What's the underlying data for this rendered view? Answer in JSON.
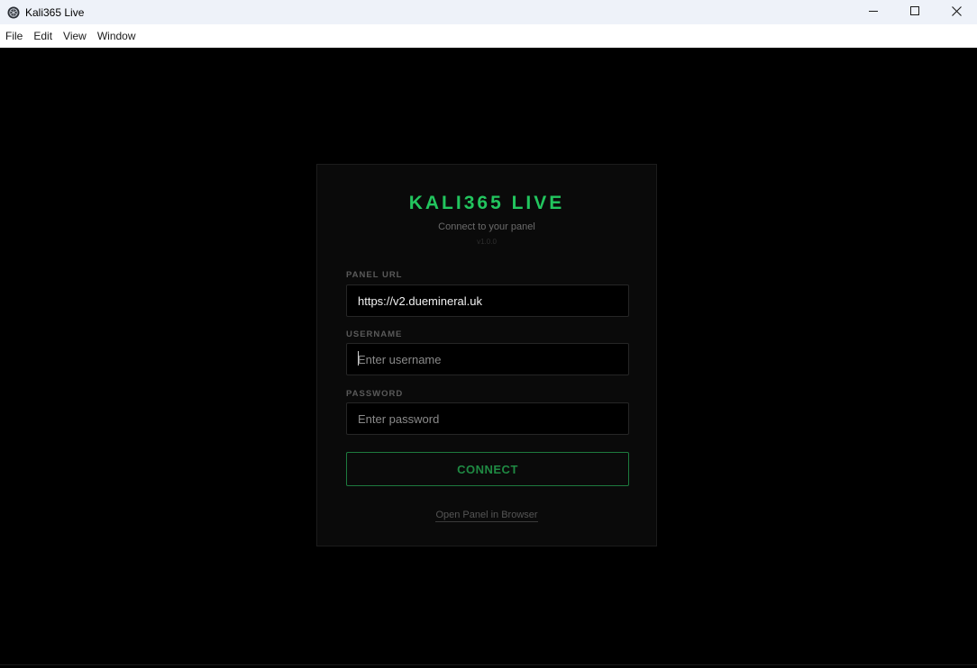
{
  "window": {
    "title": "Kali365 Live",
    "icon": "app-logo-icon",
    "controls": [
      "minimize-icon",
      "maximize-icon",
      "close-icon"
    ]
  },
  "menubar": {
    "items": [
      "File",
      "Edit",
      "View",
      "Window"
    ]
  },
  "login": {
    "brand": "KALI365 LIVE",
    "subtitle": "Connect to your panel",
    "version": "v1.0.0",
    "panel_url": {
      "label": "PANEL URL",
      "value": "https://v2.duemineral.uk"
    },
    "username": {
      "label": "USERNAME",
      "placeholder": "Enter username",
      "value": ""
    },
    "password": {
      "label": "PASSWORD",
      "placeholder": "Enter password",
      "value": ""
    },
    "connect_label": "CONNECT",
    "open_browser_label": "Open Panel in Browser"
  },
  "colors": {
    "accent": "#22c55e",
    "button_border": "#1d7a3e",
    "background": "#000000",
    "card": "#0a0a0a"
  }
}
